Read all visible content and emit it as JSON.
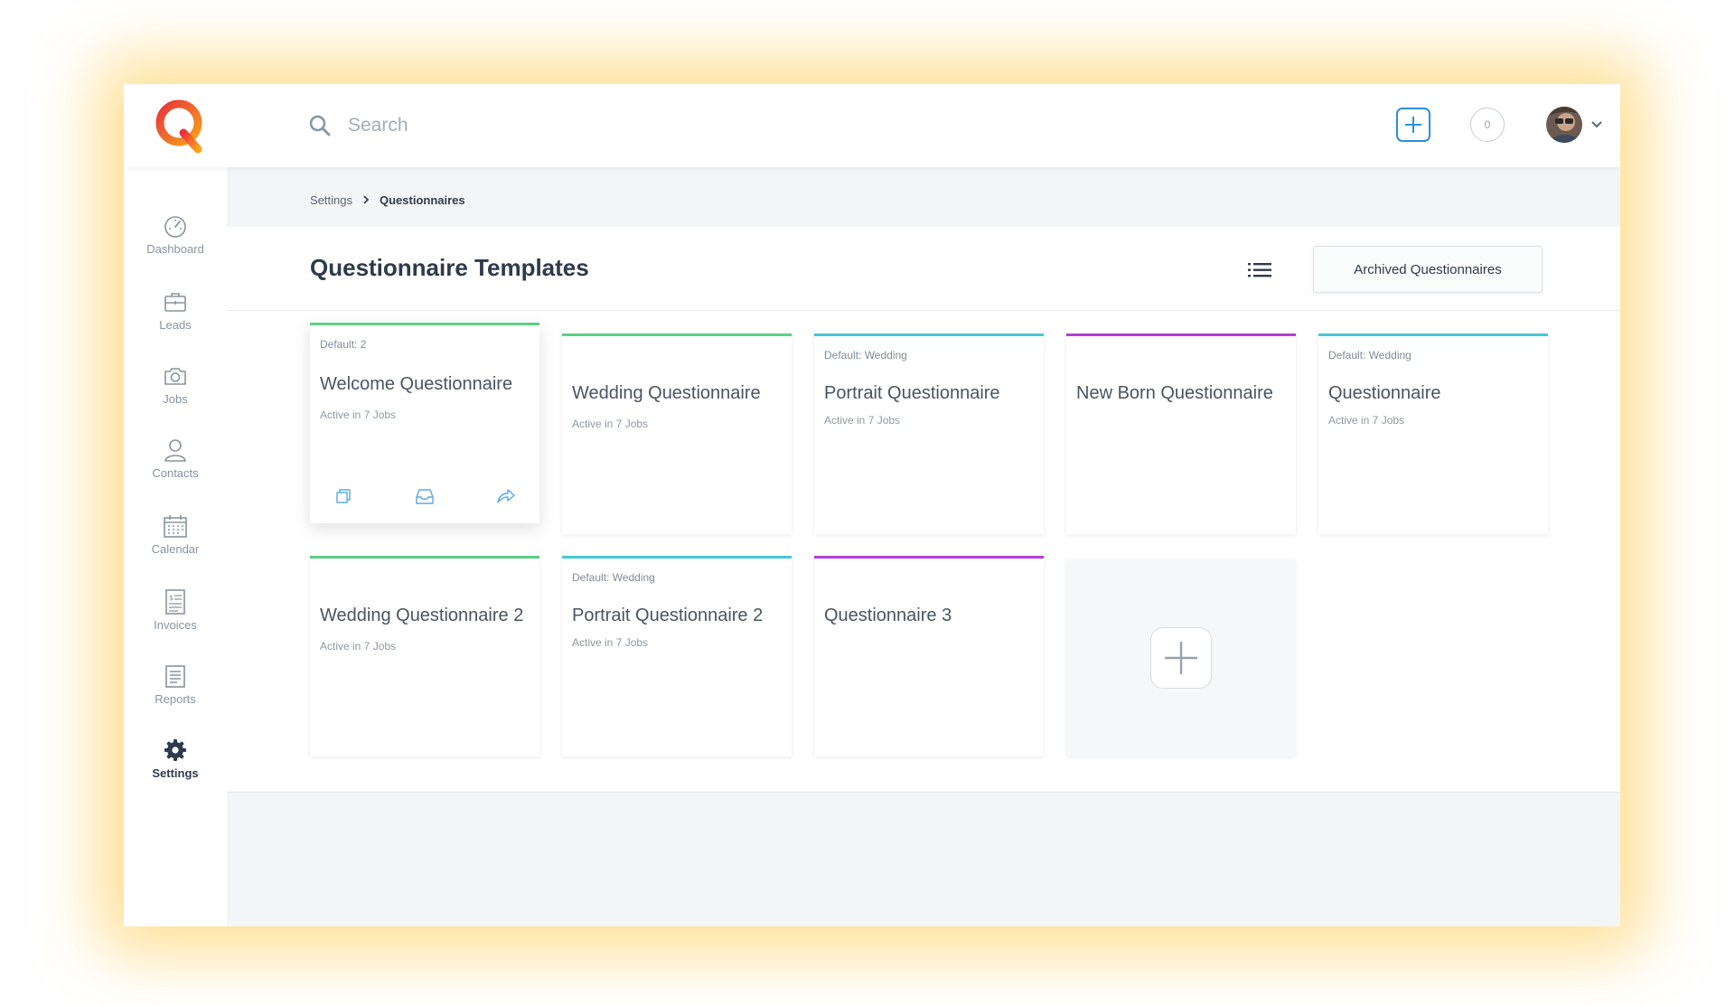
{
  "app": {
    "brand_color": "#f15a3a",
    "accent_color": "#2b8fe0"
  },
  "topbar": {
    "logo": "Q",
    "search": {
      "placeholder": "Search",
      "value": ""
    },
    "notification_count": "0"
  },
  "sidebar": {
    "items": [
      {
        "label": "Dashboard",
        "icon": "dashboard-icon"
      },
      {
        "label": "Leads",
        "icon": "briefcase-icon"
      },
      {
        "label": "Jobs",
        "icon": "camera-icon"
      },
      {
        "label": "Contacts",
        "icon": "person-icon"
      },
      {
        "label": "Calendar",
        "icon": "calendar-icon"
      },
      {
        "label": "Invoices",
        "icon": "invoice-icon"
      },
      {
        "label": "Reports",
        "icon": "report-icon"
      },
      {
        "label": "Settings",
        "icon": "gear-icon",
        "active": true
      }
    ]
  },
  "breadcrumb": {
    "parent": "Settings",
    "current": "Questionnaires"
  },
  "page": {
    "title": "Questionnaire Templates",
    "archived_button": "Archived Questionnaires"
  },
  "cards": [
    {
      "default_label": "Default: 2",
      "title": "Welcome Questionnaire",
      "status": "Active in 7 Jobs",
      "accent": "#5dcf86"
    },
    {
      "default_label": "",
      "title": "Wedding Questionnaire",
      "status": "Active in 7 Jobs",
      "accent": "#5dcf86"
    },
    {
      "default_label": "Default: Wedding",
      "title": "Portrait Questionnaire",
      "status": "Active in 7 Jobs",
      "accent": "#47c9d1"
    },
    {
      "default_label": "",
      "title": "New Born Questionnaire",
      "status": "",
      "accent": "#b23fd6"
    },
    {
      "default_label": "Default: Wedding",
      "title": "Questionnaire",
      "status": "Active in 7 Jobs",
      "accent": "#47c9d1"
    },
    {
      "default_label": "",
      "title": "Wedding Questionnaire 2",
      "status": "Active in 7 Jobs",
      "accent": "#5dcf86"
    },
    {
      "default_label": "Default: Wedding",
      "title": "Portrait Questionnaire 2",
      "status": "Active in 7 Jobs",
      "accent": "#47c9d1"
    },
    {
      "default_label": "",
      "title": "Questionnaire 3",
      "status": "",
      "accent": "#b23fd6"
    }
  ],
  "card_actions": [
    "duplicate-icon",
    "inbox-icon",
    "share-icon"
  ]
}
